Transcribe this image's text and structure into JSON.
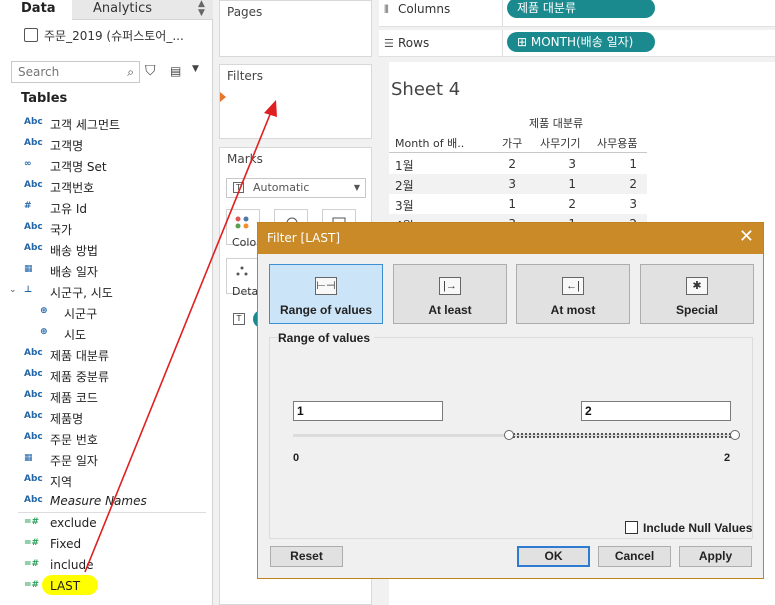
{
  "data_pane": {
    "tab_data": "Data",
    "tab_analytics": "Analytics",
    "datasource": "주문_2019 (슈퍼스토어_...",
    "search_placeholder": "Search",
    "tables_title": "Tables",
    "fields": [
      {
        "type": "Abc",
        "label": "고객 세그먼트"
      },
      {
        "type": "Abc",
        "label": "고객명"
      },
      {
        "type": "∞",
        "label": "고객명 Set"
      },
      {
        "type": "Abc",
        "label": "고객번호"
      },
      {
        "type": "#",
        "label": "고유 Id"
      },
      {
        "type": "Abc",
        "label": "국가"
      },
      {
        "type": "Abc",
        "label": "배송 방법"
      },
      {
        "type": "▦",
        "label": "배송 일자"
      },
      {
        "type": "⊥",
        "label": "시군구, 시도"
      },
      {
        "type": "⊕",
        "label": "시군구"
      },
      {
        "type": "⊕",
        "label": "시도"
      },
      {
        "type": "Abc",
        "label": "제품 대분류"
      },
      {
        "type": "Abc",
        "label": "제품 중분류"
      },
      {
        "type": "Abc",
        "label": "제품 코드"
      },
      {
        "type": "Abc",
        "label": "제품명"
      },
      {
        "type": "Abc",
        "label": "주문 번호"
      },
      {
        "type": "▦",
        "label": "주문 일자"
      },
      {
        "type": "Abc",
        "label": "지역"
      },
      {
        "type": "Abc",
        "label": "Measure Names"
      }
    ],
    "measures": [
      {
        "type": "=#",
        "label": "exclude"
      },
      {
        "type": "=#",
        "label": "Fixed"
      },
      {
        "type": "=#",
        "label": "include"
      },
      {
        "type": "=#",
        "label": "LAST"
      }
    ]
  },
  "cards": {
    "pages": "Pages",
    "filters": "Filters",
    "marks": "Marks",
    "mark_type": "Automatic",
    "color_label": "Colo",
    "detail_label": "Deta"
  },
  "shelves": {
    "columns_label": "Columns",
    "columns_pill": "제품 대분류",
    "rows_label": "Rows",
    "rows_pill": "⊞ MONTH(배송 일자)"
  },
  "sheet": {
    "title": "Sheet 4",
    "group_header": "제품 대분류",
    "columns": [
      "Month of 배..",
      "가구",
      "사무기기",
      "사무용품"
    ],
    "rows": [
      [
        "1월",
        "2",
        "3",
        "1"
      ],
      [
        "2월",
        "3",
        "1",
        "2"
      ],
      [
        "3월",
        "1",
        "2",
        "3"
      ],
      [
        "4월",
        "3",
        "1",
        "2"
      ]
    ]
  },
  "dialog": {
    "title": "Filter [LAST]",
    "close": "✕",
    "modes": [
      "Range of values",
      "At least",
      "At most",
      "Special"
    ],
    "section_title": "Range of values",
    "min_value": "1",
    "max_value": "2",
    "range_min_label": "0",
    "range_max_label": "2",
    "slider_low": 1,
    "slider_high": 2,
    "include_null": "Include Null Values",
    "buttons": {
      "reset": "Reset",
      "ok": "OK",
      "cancel": "Cancel",
      "apply": "Apply"
    }
  },
  "colors": {
    "pill": "#1a8a8f",
    "dialog_title": "#c98a27",
    "active_mode": "#cce4f7",
    "highlight": "#ffff00",
    "arrow": "#e02020"
  }
}
